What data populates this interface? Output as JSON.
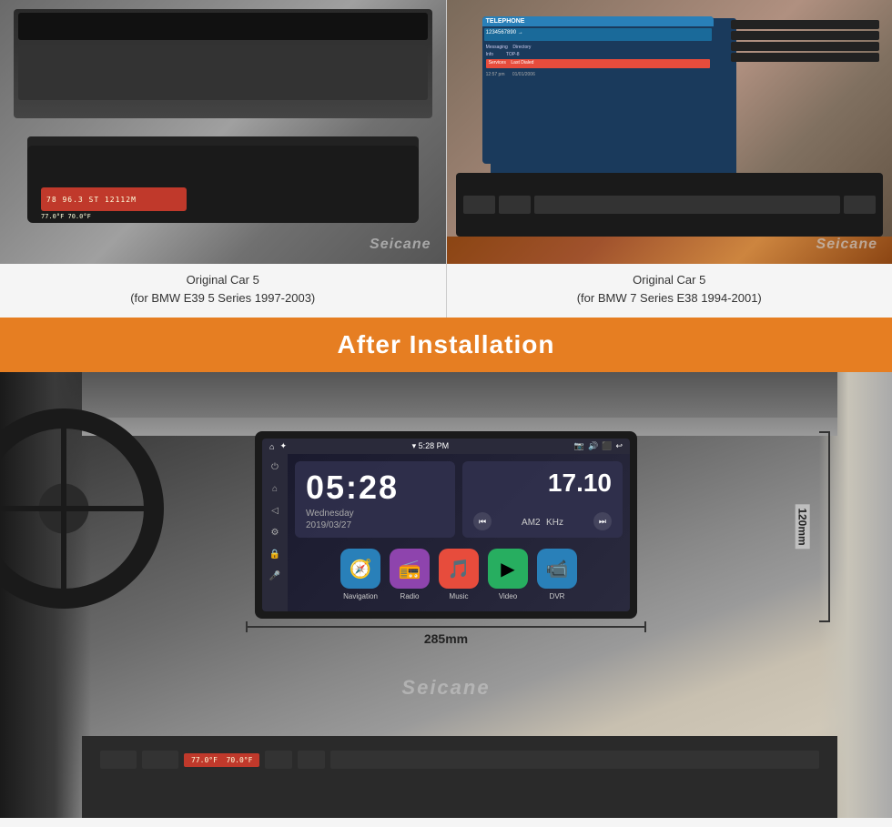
{
  "top_section": {
    "car1": {
      "caption_line1": "Original Car 5",
      "caption_line2": "(for BMW E39 5 Series 1997-2003)"
    },
    "car2": {
      "caption_line1": "Original Car 5",
      "caption_line2": "(for BMW 7 Series E38 1994-2001)"
    }
  },
  "after_banner": {
    "title": "After Installation"
  },
  "device": {
    "status_bar": {
      "home_icon": "⌂",
      "settings_icon": "✦",
      "time": "5:28 PM",
      "camera_icon": "📷",
      "volume_icon": "🔊",
      "screen_icon": "⬛",
      "back_icon": "↩"
    },
    "side_nav": {
      "power_icon": "⏻",
      "home_icon": "⌂",
      "back_icon": "◁",
      "settings_icon": "⚙",
      "lock_icon": "🔒",
      "mic_icon": "🎤"
    },
    "time_display": "05:28",
    "day": "Wednesday",
    "date": "2019/03/27",
    "freq": "17.10",
    "radio_band": "AM2",
    "radio_unit": "KHz",
    "prev_btn": "⏮",
    "next_btn": "⏭",
    "apps": [
      {
        "label": "Navigation",
        "color": "#2980b9",
        "icon": "🧭"
      },
      {
        "label": "Radio",
        "color": "#8e44ad",
        "icon": "📻"
      },
      {
        "label": "Music",
        "color": "#e74c3c",
        "icon": "🎵"
      },
      {
        "label": "Video",
        "color": "#27ae60",
        "icon": "▶"
      },
      {
        "label": "DVR",
        "color": "#2980b9",
        "icon": "📹"
      }
    ]
  },
  "dimensions": {
    "width": "285mm",
    "height": "120mm"
  },
  "watermark": "Seicane"
}
